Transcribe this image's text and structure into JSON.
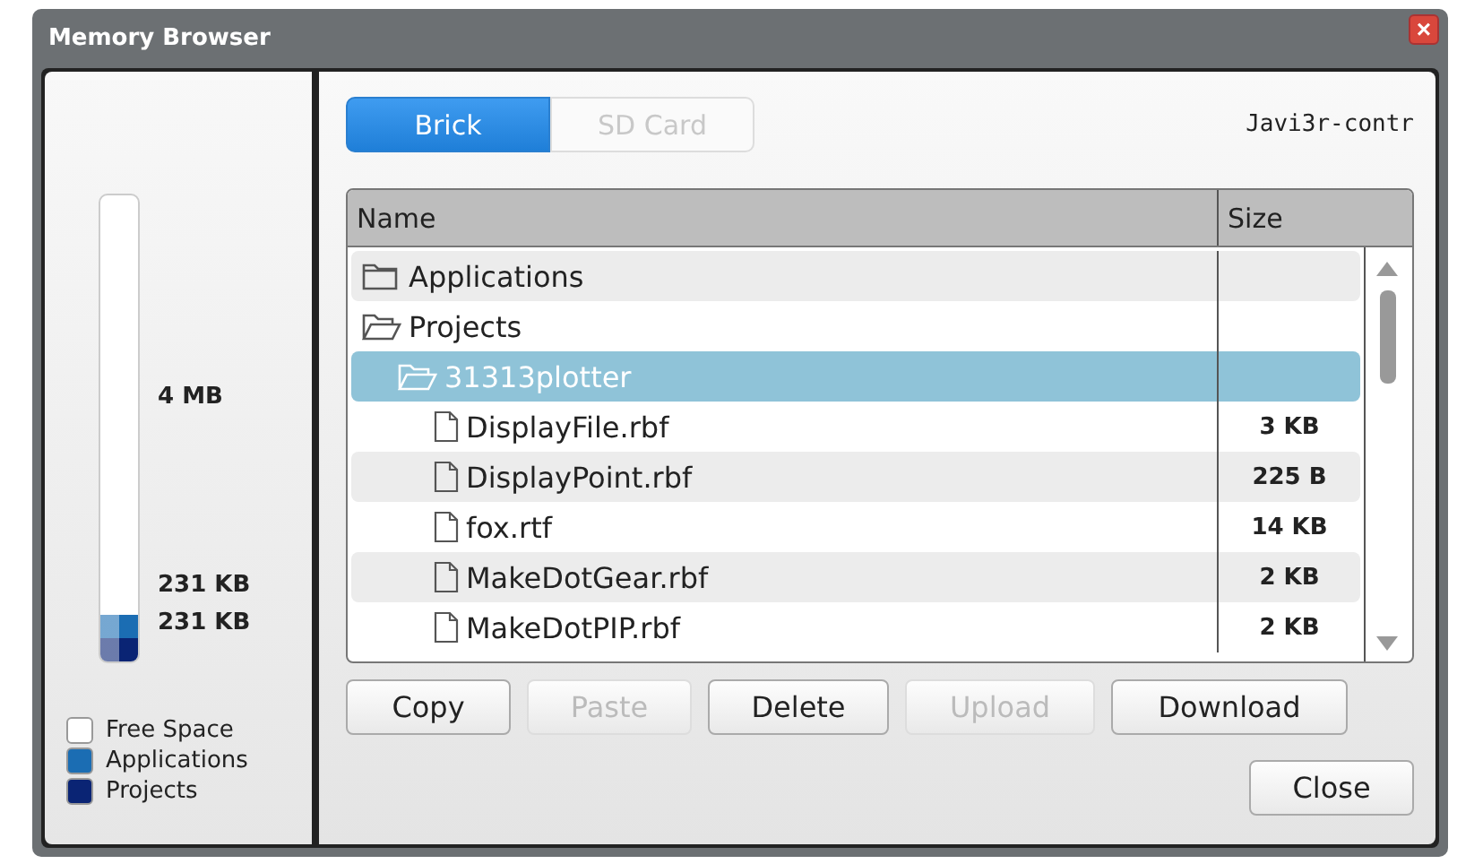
{
  "window": {
    "title": "Memory Browser",
    "close": "×"
  },
  "memory": {
    "total": "4 MB",
    "labels": [
      "231 KB",
      "231 KB"
    ],
    "segments": [
      {
        "color": "#0a2474",
        "level": 0.05
      },
      {
        "color": "#1b6db3",
        "level": 0.05
      }
    ]
  },
  "legend": [
    {
      "label": "Free Space",
      "color": "#ffffff"
    },
    {
      "label": "Applications",
      "color": "#1b6db3"
    },
    {
      "label": "Projects",
      "color": "#0a2474"
    }
  ],
  "tabs": [
    {
      "label": "Brick",
      "selected": true
    },
    {
      "label": "SD Card",
      "selected": false
    }
  ],
  "device": "Javi3r-contr",
  "table": {
    "columns": [
      "Name",
      "Size"
    ],
    "rows": [
      {
        "name": "Applications",
        "kind": "folder",
        "expanded": false,
        "selected": false
      },
      {
        "name": "Projects",
        "kind": "folder",
        "expanded": true,
        "selected": false,
        "children": [
          {
            "name": "31313plotter",
            "kind": "folder",
            "expanded": true,
            "selected": true,
            "children": [
              {
                "name": "DisplayFile.rbf",
                "kind": "file",
                "size": "3 KB",
                "selected": false
              },
              {
                "name": "DisplayPoint.rbf",
                "kind": "file",
                "size": "225 B",
                "selected": false
              },
              {
                "name": "fox.rtf",
                "kind": "file",
                "size": "14 KB",
                "selected": false
              },
              {
                "name": "MakeDotGear.rbf",
                "kind": "file",
                "size": "2 KB",
                "selected": false
              },
              {
                "name": "MakeDotPIP.rbf",
                "kind": "file",
                "size": "2 KB",
                "selected": false
              }
            ]
          }
        ]
      }
    ]
  },
  "actions": [
    {
      "label": "Copy",
      "disabled": false
    },
    {
      "label": "Paste",
      "disabled": true
    },
    {
      "label": "Delete",
      "disabled": false
    },
    {
      "label": "Upload",
      "disabled": true
    },
    {
      "label": "Download",
      "disabled": false
    }
  ],
  "footer_button": "Close"
}
